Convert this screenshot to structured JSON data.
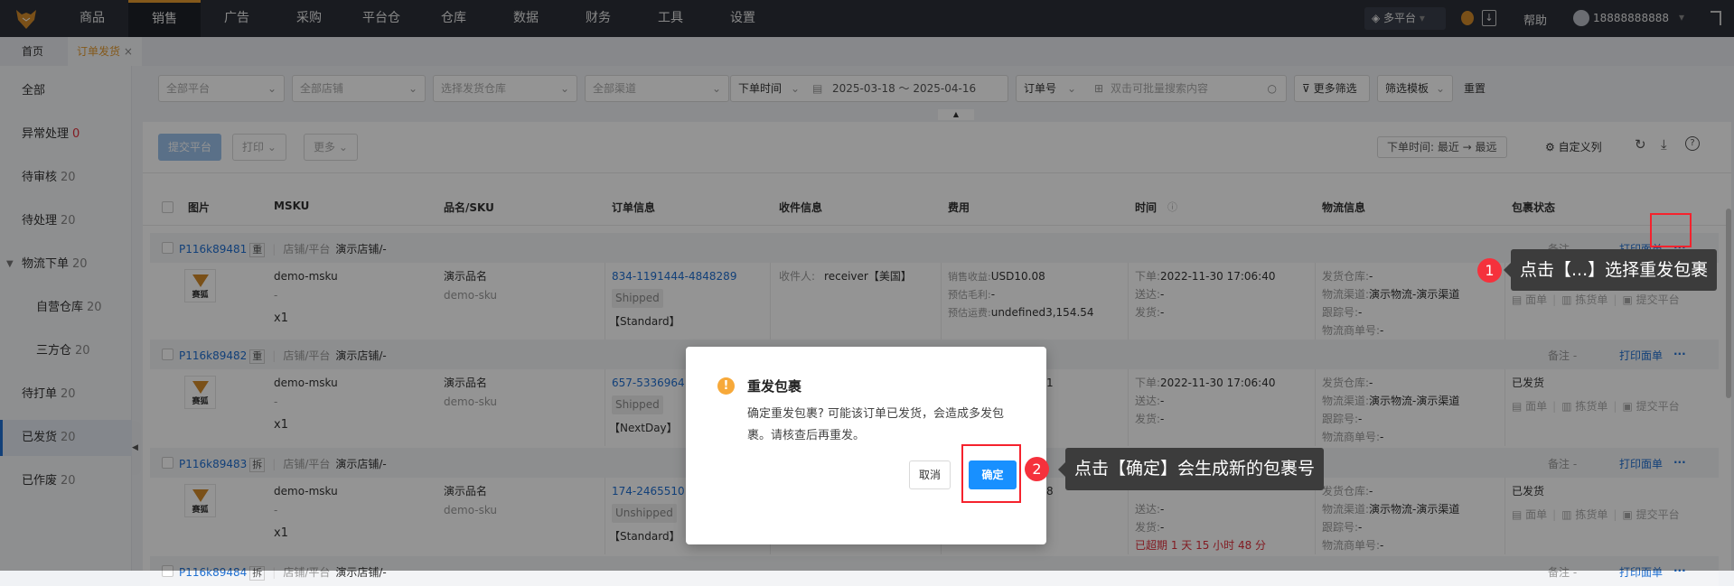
{
  "nav": {
    "items": [
      "商品",
      "销售",
      "广告",
      "采购",
      "平台仓",
      "仓库",
      "数据",
      "财务",
      "工具",
      "设置"
    ],
    "active_index": 1,
    "platform": "多平台",
    "help": "帮助",
    "user": "18888888888"
  },
  "tabs": {
    "home": "首页",
    "current": "订单发货",
    "close": "×"
  },
  "sidebar": {
    "items": [
      {
        "label": "全部",
        "count": ""
      },
      {
        "label": "异常处理",
        "count": "0"
      },
      {
        "label": "待审核",
        "count": "20"
      },
      {
        "label": "待处理",
        "count": "20"
      },
      {
        "label": "物流下单",
        "count": "20"
      },
      {
        "label": "自营仓库",
        "count": "20"
      },
      {
        "label": "三方仓",
        "count": "20"
      },
      {
        "label": "待打单",
        "count": "20"
      },
      {
        "label": "已发货",
        "count": "20"
      },
      {
        "label": "已作废",
        "count": "20"
      }
    ]
  },
  "filters": {
    "platform": "全部平台",
    "shop": "全部店铺",
    "warehouse": "选择发货仓库",
    "channel": "全部渠道",
    "time_type": "下单时间",
    "date_range": "2025-03-18 ～ 2025-04-16",
    "search_type": "订单号",
    "search_placeholder": "双击可批量搜索内容",
    "more": "更多筛选",
    "template": "筛选模板",
    "reset": "重置"
  },
  "actions": {
    "submit": "提交平台",
    "print": "打印",
    "more": "更多",
    "sort": "下单时间:  最近 → 最远",
    "custom_cols": "自定义列"
  },
  "columns": [
    "图片",
    "MSKU",
    "品名/SKU",
    "订单信息",
    "收件信息",
    "费用",
    "时间",
    "物流信息",
    "包裹状态"
  ],
  "orders": [
    {
      "id": "P116k89481",
      "tag": "重",
      "shop_label": "店铺/平台",
      "shop": "演示店铺/-",
      "msku": "demo-msku",
      "msku2": "-",
      "qty": "x1",
      "name": "演示品名",
      "sku": "demo-sku",
      "order_no": "834-1191444-4848289",
      "status": "Shipped",
      "ship": "【Standard】",
      "receiver_label": "收件人:",
      "receiver": "receiver【美国】",
      "fee": [
        [
          "销售收益:",
          "USD10.08"
        ],
        [
          "预估毛利:",
          "-"
        ],
        [
          "预估运费:",
          "undefined3,154.54"
        ]
      ],
      "time": [
        [
          "下单:",
          "2022-11-30 17:06:40"
        ],
        [
          "送达:",
          "-"
        ],
        [
          "发货:",
          "-"
        ]
      ],
      "overdue": "",
      "logi": [
        [
          "发货仓库:",
          "-"
        ],
        [
          "物流渠道:",
          "演示物流-演示渠道"
        ],
        [
          "跟踪号:",
          "-"
        ],
        [
          "物流商单号:",
          "-"
        ]
      ],
      "pkg_status": "已发货"
    },
    {
      "id": "P116k89482",
      "tag": "重",
      "shop_label": "店铺/平台",
      "shop": "演示店铺/-",
      "msku": "demo-msku",
      "msku2": "-",
      "qty": "x1",
      "name": "演示品名",
      "sku": "demo-sku",
      "order_no": "657-5336964",
      "status": "Shipped",
      "ship": "【NextDay】",
      "receiver_label": "",
      "receiver": "",
      "fee": [
        [
          "",
          "1"
        ]
      ],
      "time": [
        [
          "下单:",
          "2022-11-30 17:06:40"
        ],
        [
          "送达:",
          "-"
        ],
        [
          "发货:",
          "-"
        ]
      ],
      "overdue": "",
      "logi": [
        [
          "发货仓库:",
          "-"
        ],
        [
          "物流渠道:",
          "演示物流-演示渠道"
        ],
        [
          "跟踪号:",
          "-"
        ],
        [
          "物流商单号:",
          "-"
        ]
      ],
      "pkg_status": "已发货"
    },
    {
      "id": "P116k89483",
      "tag": "拆",
      "shop_label": "店铺/平台",
      "shop": "演示店铺/-",
      "msku": "demo-msku",
      "msku2": "-",
      "qty": "x1",
      "name": "演示品名",
      "sku": "demo-sku",
      "order_no": "174-2465510",
      "status": "Unshipped",
      "ship": "【Standard】",
      "receiver_label": "",
      "receiver": "",
      "fee": [
        [
          "",
          "8"
        ]
      ],
      "time": [
        [
          "",
          ""
        ],
        [
          "送达:",
          "-"
        ],
        [
          "发货:",
          "-"
        ]
      ],
      "overdue": "已超期 1 天 15 小时 48 分",
      "logi": [
        [
          "发货仓库:",
          "-"
        ],
        [
          "物流渠道:",
          "演示物流-演示渠道"
        ],
        [
          "跟踪号:",
          "-"
        ],
        [
          "物流商单号:",
          "-"
        ]
      ],
      "pkg_status": "已发货"
    },
    {
      "id": "P116k89484",
      "tag": "拆",
      "shop_label": "店铺/平台",
      "shop": "演示店铺/-"
    }
  ],
  "row_actions": {
    "remark": "备注 -",
    "print_label": "打印面单",
    "more": "···",
    "sheet": "面单",
    "pick": "拣货单",
    "submit": "提交平台"
  },
  "dialog": {
    "title": "重发包裹",
    "body": "确定重发包裹? 可能该订单已发货，会造成多发包裹。请核查后再重发。",
    "cancel": "取消",
    "ok": "确定"
  },
  "annotations": {
    "step1_num": "1",
    "step1": "点击【...】选择重发包裹",
    "step2_num": "2",
    "step2": "点击【确定】会生成新的包裹号"
  },
  "colors": {
    "accent": "#1f6fd1",
    "brand": "#e39a2f",
    "danger": "#f5313c"
  }
}
